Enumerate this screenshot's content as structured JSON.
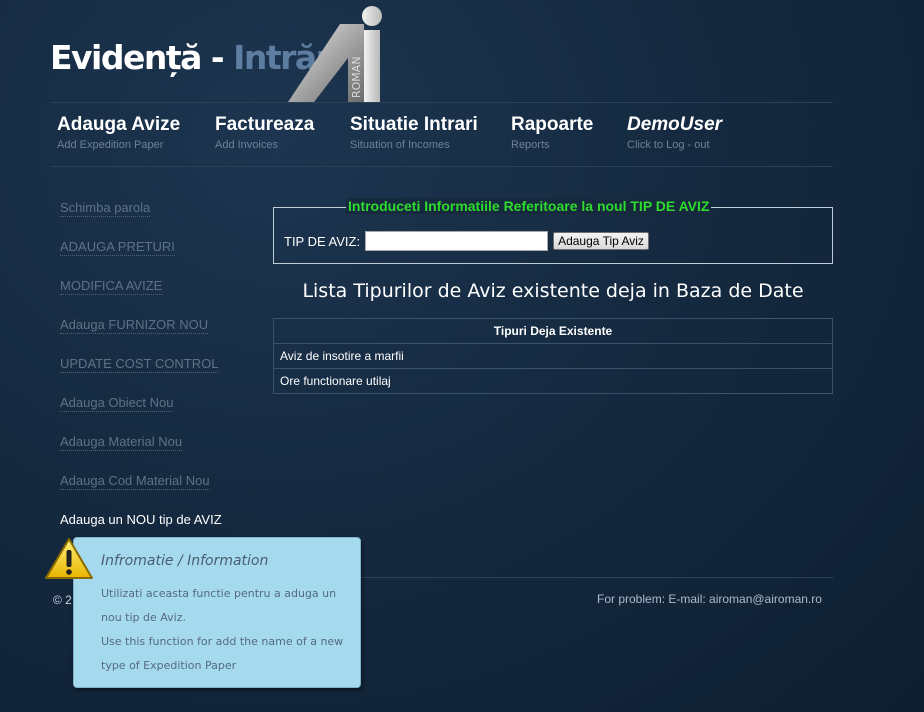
{
  "header": {
    "title_part1": "Evidență - ",
    "title_part2": "Intrări",
    "logo_letters": "AI",
    "logo_text": "ROMAN"
  },
  "nav": [
    {
      "label": "Adauga Avize",
      "sub": "Add Expedition Paper"
    },
    {
      "label": "Factureaza",
      "sub": "Add Invoices"
    },
    {
      "label": "Situatie Intrari",
      "sub": "Situation of Incomes"
    },
    {
      "label": "Rapoarte",
      "sub": "Reports"
    },
    {
      "label": "DemoUser",
      "sub": "Click to Log - out"
    }
  ],
  "sidebar": {
    "items": [
      {
        "label": "Schimba parola"
      },
      {
        "label": "ADAUGA PRETURI"
      },
      {
        "label": "MODIFICA AVIZE"
      },
      {
        "label": "Adauga FURNIZOR NOU"
      },
      {
        "label": "UPDATE COST CONTROL"
      },
      {
        "label": "Adauga Obiect Nou"
      },
      {
        "label": "Adauga Material Nou"
      },
      {
        "label": "Adauga Cod Material Nou"
      },
      {
        "label": "Adauga un NOU tip de AVIZ"
      }
    ]
  },
  "form": {
    "legend": "Introduceti Informatiile Referitoare la noul TIP DE AVIZ",
    "label": "TIP DE AVIZ:",
    "input_value": "",
    "button_label": "Adauga Tip Aviz"
  },
  "list": {
    "heading": "Lista Tipurilor de Aviz existente deja in Baza de Date",
    "column_header": "Tipuri Deja Existente",
    "rows": [
      "Aviz de insotire a marfii",
      "Ore functionare utilaj"
    ]
  },
  "footer": {
    "copyright": "© 2",
    "contact": "For problem: E-mail: airoman@airoman.ro"
  },
  "tooltip": {
    "title": "Infromatie / Information",
    "line1": "Utilizati aceasta functie pentru a aduga un nou tip de Aviz.",
    "line2": "Use this function for add the name of a new type of Expedition Paper"
  },
  "icons": {
    "warning": "warning-icon"
  },
  "colors": {
    "legend_green": "#2ddc2d",
    "tooltip_bg": "#a4d9ee",
    "title_accent": "#5d7ea0"
  }
}
